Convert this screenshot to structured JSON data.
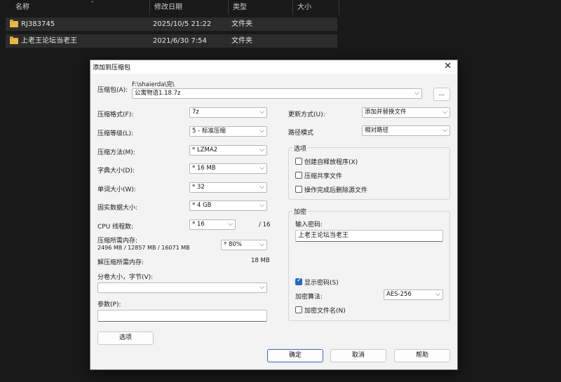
{
  "explorer": {
    "columns": [
      "名称",
      "修改日期",
      "类型",
      "大小"
    ],
    "rows": [
      {
        "name": "RJ383745",
        "date": "2025/10/5 21:22",
        "type": "文件夹"
      },
      {
        "name": "上老王论坛当老王",
        "date": "2021/6/30 7:54",
        "type": "文件夹"
      }
    ]
  },
  "dialog": {
    "title": "添加到压缩包",
    "archive_label": "压缩包(A):",
    "archive_path": "F:\\shaierda\\完\\",
    "archive_name": "公寓物语1.18.7z",
    "browse_label": "...",
    "format_label": "压缩格式(F):",
    "format_value": "7z",
    "level_label": "压缩等级(L):",
    "level_value": "5 - 标准压缩",
    "method_label": "压缩方法(M):",
    "method_value": "* LZMA2",
    "dict_label": "字典大小(D):",
    "dict_value": "* 16 MB",
    "word_label": "单词大小(W):",
    "word_value": "* 32",
    "solid_label": "固实数据大小:",
    "solid_value": "* 4 GB",
    "cpu_label": "CPU 线程数:",
    "cpu_value": "* 16",
    "cpu_total": "/ 16",
    "mem_label": "压缩所需内存:",
    "mem_detail": "2496 MB / 12857 MB / 16071 MB",
    "mem_value": "* 80%",
    "decomp_label": "解压缩所需内存:",
    "decomp_value": "18 MB",
    "split_label": "分卷大小，字节(V):",
    "split_value": "",
    "params_label": "参数(P):",
    "params_value": "",
    "options_button": "选项",
    "update_label": "更新方式(U):",
    "update_value": "添加并替换文件",
    "pathmode_label": "路径模式",
    "pathmode_value": "相对路径",
    "options_group": "选项",
    "opt_sfx": "创建自释放程序(X)",
    "opt_shared": "压缩共享文件",
    "opt_delete": "操作完成后删除源文件",
    "encrypt_group": "加密",
    "password_label": "输入密码:",
    "password_value": "上老王论坛当老王",
    "show_password": "显示密码(S)",
    "enc_method_label": "加密算法:",
    "enc_method_value": "AES-256",
    "encrypt_names": "加密文件名(N)",
    "ok": "确定",
    "cancel": "取消",
    "help": "帮助"
  }
}
